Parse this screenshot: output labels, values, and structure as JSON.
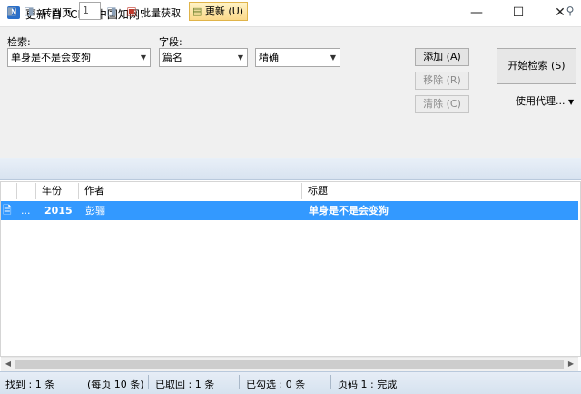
{
  "window": {
    "title": "更新 自 \"CNKI中国知网\"",
    "app_icon_glyph": "N",
    "minimize_glyph": "—",
    "maximize_glyph": "☐",
    "close_glyph": "✕"
  },
  "search": {
    "query_label": "检索:",
    "query_value": "单身是不是会变狗",
    "field_label": "字段:",
    "field_value": "篇名",
    "match_value": "精确",
    "add_button": "添加 (A)",
    "remove_button": "移除 (R)",
    "clear_button": "清除 (C)",
    "start_button": "开始检索 (S)",
    "proxy_label": "使用代理..."
  },
  "toolbar": {
    "goto_page_label": "转到页",
    "page_value": "1",
    "batch_label": "批量获取",
    "update_label": "更新 (U)"
  },
  "table": {
    "columns": [
      "年份",
      "作者",
      "标题"
    ],
    "rows": [
      {
        "extra": "...",
        "year": "2015",
        "author": "彭骊",
        "title": "单身是不是会变狗"
      }
    ]
  },
  "status": {
    "found": "找到 : 1 条",
    "per_page": "(每页 10 条)",
    "returned": "已取回 : 1 条",
    "checked": "已勾选 : 0 条",
    "page_status": "页码 1 : 完成"
  },
  "colors": {
    "selection": "#3399ff",
    "accent_update": "#fbd98a"
  }
}
